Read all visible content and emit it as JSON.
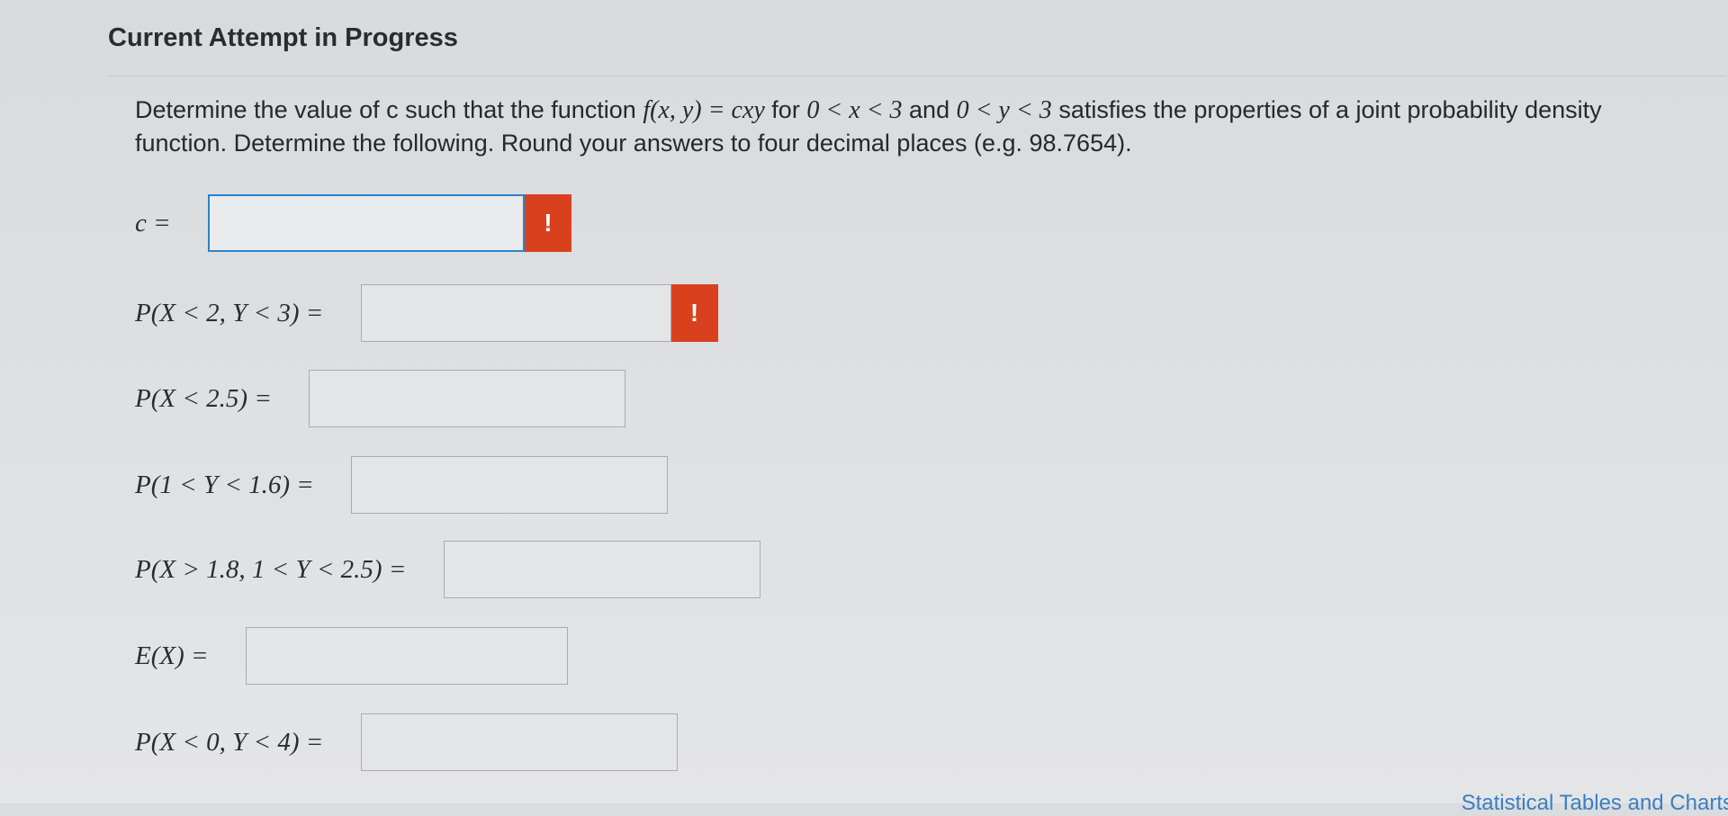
{
  "header": {
    "title": "Current Attempt in Progress"
  },
  "problem": {
    "t1": "Determine the value of c such that the function ",
    "m1": "f(x, y) = cxy",
    "t2": " for ",
    "m2": "0 < x < 3",
    "t3": " and ",
    "m3": "0 < y < 3",
    "t4": " satisfies the properties of a joint probability density function. Determine the following. Round your answers to four decimal places (e.g. 98.7654)."
  },
  "questions": [
    {
      "label": "c = ",
      "value": "",
      "flag": "!"
    },
    {
      "label": "P(X < 2, Y < 3) = ",
      "value": "",
      "flag": "!"
    },
    {
      "label": "P(X < 2.5) = ",
      "value": ""
    },
    {
      "label": "P(1 < Y < 1.6) = ",
      "value": ""
    },
    {
      "label": "P(X > 1.8, 1 < Y < 2.5) = ",
      "value": ""
    },
    {
      "label": "E(X) = ",
      "value": ""
    },
    {
      "label": "P(X < 0, Y < 4) = ",
      "value": ""
    }
  ],
  "footer": {
    "link_label": "Statistical Tables and Charts"
  },
  "colors": {
    "alert": "#d9401e",
    "focus_border": "#2a83c9",
    "link": "#3a7fc4"
  }
}
